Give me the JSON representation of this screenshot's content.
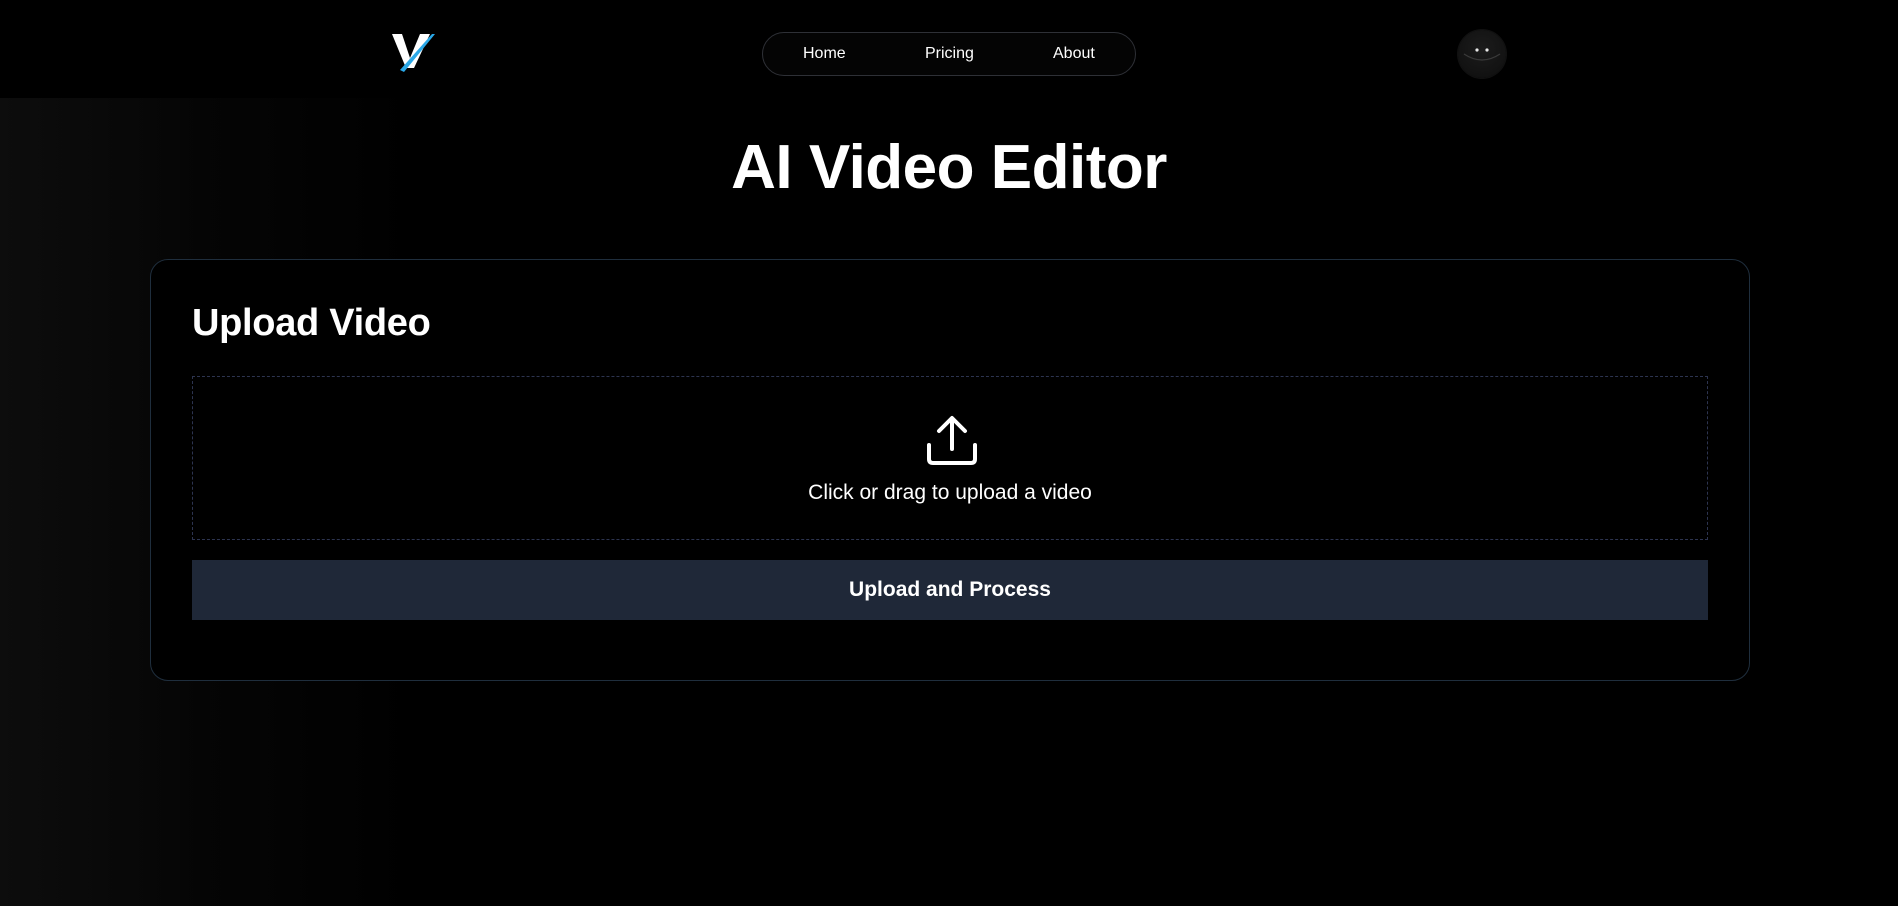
{
  "header": {
    "logo_icon": "v-logo-icon",
    "nav": [
      {
        "label": "Home"
      },
      {
        "label": "Pricing"
      },
      {
        "label": "About"
      }
    ],
    "avatar_icon": "smiley-avatar-icon"
  },
  "main": {
    "title": "AI Video Editor",
    "upload_card": {
      "title": "Upload Video",
      "dropzone_icon": "upload-icon",
      "dropzone_text": "Click or drag to upload a video",
      "submit_label": "Upload and Process"
    }
  },
  "colors": {
    "background": "#000000",
    "card_border": "#1f2e3d",
    "dropzone_border": "#2d3450",
    "button_bg": "#1f2838",
    "logo_accent": "#2aa8e8"
  }
}
